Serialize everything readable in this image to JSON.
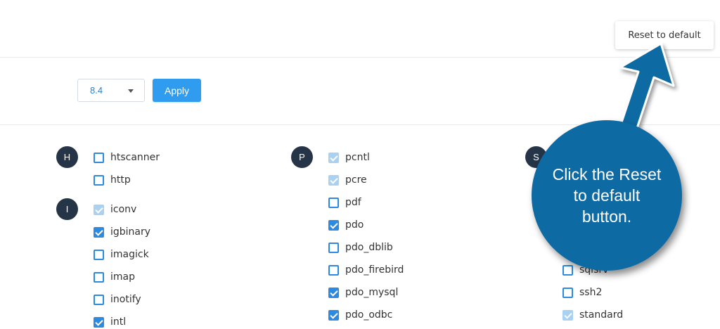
{
  "header": {
    "reset_label": "Reset to default"
  },
  "toolbar": {
    "version_value": "8.4",
    "apply_label": "Apply"
  },
  "groups": {
    "h": "H",
    "i": "I",
    "p": "P",
    "s": "S"
  },
  "extensions": {
    "htscanner": {
      "label": "htscanner",
      "state": "unchecked"
    },
    "http": {
      "label": "http",
      "state": "unchecked"
    },
    "iconv": {
      "label": "iconv",
      "state": "disabled-checked"
    },
    "igbinary": {
      "label": "igbinary",
      "state": "checked"
    },
    "imagick": {
      "label": "imagick",
      "state": "unchecked"
    },
    "imap": {
      "label": "imap",
      "state": "unchecked"
    },
    "inotify": {
      "label": "inotify",
      "state": "unchecked"
    },
    "intl": {
      "label": "intl",
      "state": "checked"
    },
    "pcntl": {
      "label": "pcntl",
      "state": "disabled-checked"
    },
    "pcre": {
      "label": "pcre",
      "state": "disabled-checked"
    },
    "pdf": {
      "label": "pdf",
      "state": "unchecked"
    },
    "pdo": {
      "label": "pdo",
      "state": "checked"
    },
    "pdo_dblib": {
      "label": "pdo_dblib",
      "state": "unchecked"
    },
    "pdo_firebird": {
      "label": "pdo_firebird",
      "state": "unchecked"
    },
    "pdo_mysql": {
      "label": "pdo_mysql",
      "state": "checked"
    },
    "pdo_odbc": {
      "label": "pdo_odbc",
      "state": "checked"
    },
    "sqlsrv": {
      "label": "sqlsrv",
      "state": "unchecked"
    },
    "ssh2": {
      "label": "ssh2",
      "state": "unchecked"
    },
    "standard": {
      "label": "standard",
      "state": "disabled-checked"
    }
  },
  "callout": {
    "text": "Click the Reset to default button."
  },
  "colors": {
    "primary": "#2f9cf0",
    "checkbox": "#2c8ae0",
    "checkbox_disabled": "#a9d1f2",
    "letter_badge": "#253447",
    "callout": "#0e6aa3"
  }
}
